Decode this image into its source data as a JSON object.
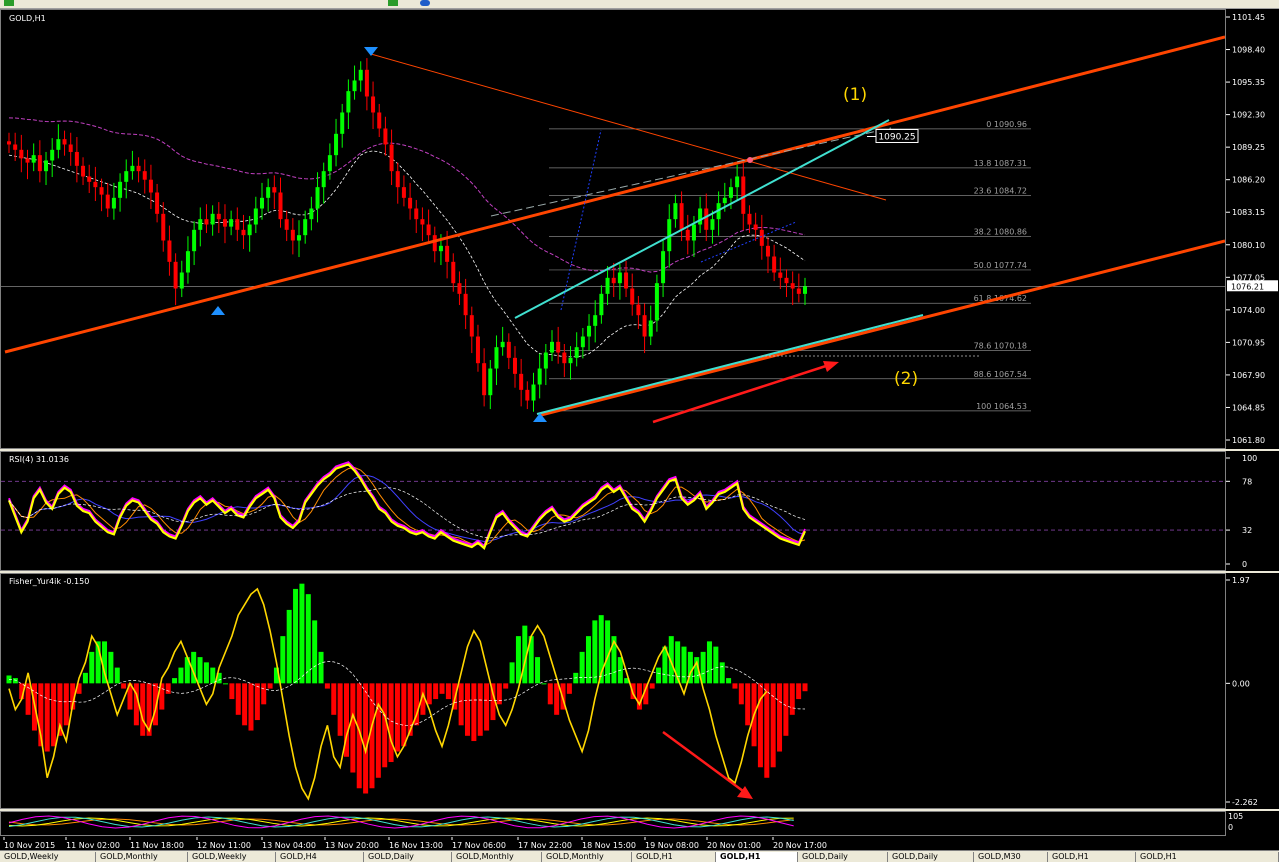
{
  "chart_data": [
    {
      "type": "line",
      "title": "GOLD,H1",
      "ylim": [
        1061.8,
        1101.45
      ],
      "yticks": [
        "1101.45",
        "1098.40",
        "1095.35",
        "1092.30",
        "1089.25",
        "1086.20",
        "1083.15",
        "1080.10",
        "1077.05",
        "1074.00",
        "1070.95",
        "1067.90",
        "1064.85",
        "1061.80"
      ],
      "current_price": "1076.21",
      "price_marker": "1090.25",
      "annotations": [
        "(1)",
        "(2)"
      ],
      "fib_levels": [
        {
          "label": "0 1090.96",
          "value": 1090.96
        },
        {
          "label": "13.8 1087.31",
          "value": 1087.31
        },
        {
          "label": "23.6 1084.72",
          "value": 1084.72
        },
        {
          "label": "38.2 1080.86",
          "value": 1080.86
        },
        {
          "label": "50.0 1077.74",
          "value": 1077.74
        },
        {
          "label": "61.8 1074.62",
          "value": 1074.62
        },
        {
          "label": "78.6 1070.18",
          "value": 1070.18
        },
        {
          "label": "88.6 1067.54",
          "value": 1067.54
        },
        {
          "label": "100 1064.53",
          "value": 1064.53
        }
      ],
      "close": [
        1089.5,
        1089.0,
        1088.2,
        1087.8,
        1088.5,
        1087.0,
        1088.0,
        1089.0,
        1090.0,
        1089.5,
        1088.8,
        1087.5,
        1086.5,
        1086.0,
        1085.5,
        1084.8,
        1083.5,
        1084.5,
        1086.0,
        1087.0,
        1087.5,
        1087.0,
        1086.2,
        1085.0,
        1083.0,
        1080.5,
        1078.5,
        1076.0,
        1077.5,
        1079.5,
        1081.5,
        1082.5,
        1082.0,
        1083.0,
        1082.5,
        1081.8,
        1082.5,
        1081.5,
        1081.0,
        1082.0,
        1083.5,
        1084.5,
        1085.5,
        1085.0,
        1082.5,
        1081.5,
        1080.5,
        1081.0,
        1082.5,
        1083.5,
        1085.5,
        1087.0,
        1088.5,
        1090.5,
        1092.5,
        1094.5,
        1095.5,
        1096.5,
        1094.0,
        1092.5,
        1091.0,
        1089.5,
        1087.0,
        1085.5,
        1084.5,
        1083.5,
        1082.5,
        1082.0,
        1081.0,
        1079.5,
        1080.0,
        1078.5,
        1076.5,
        1075.5,
        1073.5,
        1071.5,
        1069.0,
        1066.0,
        1068.5,
        1070.5,
        1071.0,
        1069.5,
        1068.0,
        1066.5,
        1065.5,
        1067.0,
        1068.5,
        1070.0,
        1071.0,
        1070.0,
        1069.0,
        1069.5,
        1070.5,
        1071.5,
        1072.5,
        1073.5,
        1075.5,
        1077.0,
        1076.5,
        1077.5,
        1076.0,
        1074.5,
        1073.5,
        1071.5,
        1073.0,
        1076.5,
        1079.5,
        1082.5,
        1084.0,
        1081.5,
        1080.5,
        1082.0,
        1083.5,
        1081.5,
        1082.5,
        1084.0,
        1084.5,
        1085.5,
        1086.5,
        1083.0,
        1082.0,
        1081.5,
        1080.0,
        1079.0,
        1077.5,
        1077.0,
        1076.5,
        1076.0,
        1075.5,
        1076.2
      ],
      "ma_fast": [
        1088.5,
        1088.4,
        1088.3,
        1088.2,
        1088.1,
        1088.0,
        1087.8,
        1087.6,
        1087.4,
        1087.2,
        1087.0,
        1086.8,
        1086.6,
        1086.4,
        1086.2,
        1086.0,
        1085.8,
        1085.6,
        1085.4,
        1085.3,
        1085.1,
        1084.9,
        1084.6,
        1084.3,
        1084.0,
        1083.6,
        1083.2,
        1082.8,
        1082.5,
        1082.3,
        1082.2,
        1082.1,
        1082.1,
        1082.2,
        1082.2,
        1082.2,
        1082.3,
        1082.3,
        1082.3,
        1082.4,
        1082.5,
        1082.8,
        1083.1,
        1083.3,
        1083.3,
        1083.2,
        1083.0,
        1082.9,
        1082.9,
        1083.1,
        1083.5,
        1084.0,
        1084.6,
        1085.3,
        1086.1,
        1087.0,
        1087.8,
        1088.5,
        1088.8,
        1088.9,
        1088.8,
        1088.6,
        1088.2,
        1087.7,
        1087.1,
        1086.5,
        1085.8,
        1085.2,
        1084.5,
        1083.8,
        1083.1,
        1082.4,
        1081.6,
        1080.8,
        1079.9,
        1078.9,
        1077.8,
        1076.6,
        1075.6,
        1074.7,
        1074.0,
        1073.2,
        1072.4,
        1071.6,
        1070.8,
        1070.3,
        1069.9,
        1069.8,
        1069.8,
        1069.7,
        1069.6,
        1069.6,
        1069.6,
        1069.7,
        1069.9,
        1070.3,
        1070.8,
        1071.4,
        1071.8,
        1072.2,
        1072.5,
        1072.6,
        1072.6,
        1072.5,
        1072.6,
        1073.0,
        1073.6,
        1074.4,
        1075.2,
        1075.7,
        1076.1,
        1076.6,
        1077.2,
        1077.6,
        1078.0,
        1078.6,
        1079.2,
        1079.9,
        1080.6,
        1080.9,
        1081.0,
        1081.0,
        1080.9,
        1080.7,
        1080.4,
        1080.1,
        1079.8,
        1079.4,
        1079.0,
        1078.6
      ]
    },
    {
      "type": "line",
      "title": "RSI(4) 31.0136",
      "ylim": [
        0,
        100
      ],
      "yticks": [
        "100",
        "78",
        "32",
        "0"
      ],
      "levels": [
        78,
        32
      ],
      "values": [
        60,
        45,
        30,
        40,
        62,
        70,
        58,
        52,
        66,
        72,
        68,
        55,
        50,
        48,
        40,
        35,
        30,
        28,
        44,
        55,
        60,
        58,
        50,
        42,
        38,
        30,
        26,
        24,
        36,
        50,
        58,
        62,
        56,
        60,
        54,
        48,
        52,
        46,
        44,
        54,
        62,
        66,
        70,
        62,
        44,
        38,
        34,
        40,
        58,
        66,
        74,
        80,
        84,
        90,
        92,
        94,
        88,
        80,
        70,
        62,
        52,
        48,
        40,
        36,
        34,
        30,
        28,
        30,
        26,
        24,
        30,
        26,
        22,
        20,
        18,
        16,
        20,
        15,
        30,
        44,
        48,
        40,
        34,
        28,
        26,
        34,
        42,
        48,
        52,
        44,
        40,
        42,
        48,
        54,
        58,
        62,
        70,
        74,
        68,
        72,
        62,
        52,
        48,
        40,
        50,
        62,
        70,
        78,
        80,
        62,
        56,
        60,
        66,
        52,
        58,
        66,
        68,
        72,
        76,
        52,
        44,
        40,
        36,
        32,
        28,
        24,
        22,
        20,
        18,
        31
      ]
    },
    {
      "type": "bar",
      "title": "Fisher_Yur4ik -0.150",
      "ylim": [
        -2.262,
        1.97
      ],
      "yticks": [
        "1.97",
        "0.00",
        "-2.262"
      ],
      "histogram": [
        0.15,
        0.1,
        -0.3,
        -0.6,
        -0.9,
        -1.2,
        -1.3,
        -1.2,
        -1.0,
        -0.8,
        -0.5,
        -0.2,
        0.2,
        0.6,
        0.8,
        0.8,
        0.6,
        0.3,
        -0.1,
        -0.5,
        -0.8,
        -1.0,
        -1.0,
        -0.8,
        -0.5,
        -0.2,
        0.1,
        0.3,
        0.5,
        0.6,
        0.5,
        0.4,
        0.3,
        0.2,
        0.0,
        -0.3,
        -0.6,
        -0.8,
        -0.9,
        -0.7,
        -0.4,
        -0.1,
        0.3,
        0.9,
        1.4,
        1.8,
        1.9,
        1.7,
        1.2,
        0.6,
        -0.1,
        -0.6,
        -1.0,
        -1.4,
        -1.7,
        -2.0,
        -2.1,
        -2.0,
        -1.8,
        -1.6,
        -1.5,
        -1.3,
        -1.2,
        -1.0,
        -0.8,
        -0.6,
        -0.4,
        -0.3,
        -0.2,
        -0.3,
        -0.5,
        -0.8,
        -1.0,
        -1.1,
        -1.0,
        -0.9,
        -0.7,
        -0.4,
        -0.1,
        0.4,
        0.9,
        1.1,
        0.9,
        0.5,
        0.0,
        -0.4,
        -0.6,
        -0.5,
        -0.2,
        0.2,
        0.6,
        0.9,
        1.2,
        1.3,
        1.2,
        0.9,
        0.5,
        0.1,
        -0.3,
        -0.5,
        -0.4,
        -0.1,
        0.3,
        0.7,
        0.9,
        0.8,
        0.7,
        0.6,
        0.5,
        0.6,
        0.8,
        0.7,
        0.4,
        0.1,
        -0.1,
        -0.4,
        -0.8,
        -1.2,
        -1.6,
        -1.8,
        -1.6,
        -1.3,
        -1.0,
        -0.6,
        -0.3,
        -0.15
      ],
      "signal": [
        -0.1,
        -0.5,
        -0.3,
        0.2,
        -0.4,
        -1.0,
        -1.8,
        -1.4,
        -0.8,
        -1.1,
        -0.4,
        0.1,
        0.4,
        0.9,
        0.7,
        0.2,
        -0.2,
        -0.6,
        -0.3,
        0.0,
        -0.2,
        -0.7,
        -0.9,
        -0.5,
        0.1,
        0.3,
        0.6,
        0.8,
        0.5,
        0.2,
        -0.1,
        -0.4,
        -0.2,
        0.3,
        0.6,
        0.9,
        1.3,
        1.5,
        1.7,
        1.8,
        1.5,
        1.0,
        0.4,
        -0.3,
        -1.0,
        -1.6,
        -2.0,
        -2.2,
        -1.8,
        -1.2,
        -0.8,
        -1.4,
        -1.6,
        -1.0,
        -0.6,
        -0.9,
        -1.3,
        -0.8,
        -0.4,
        -0.6,
        -1.1,
        -1.4,
        -1.2,
        -0.9,
        -0.6,
        -0.2,
        -0.5,
        -0.9,
        -1.2,
        -0.8,
        -0.3,
        0.2,
        0.7,
        1.0,
        0.8,
        0.3,
        -0.2,
        -0.6,
        -0.8,
        -0.5,
        -0.1,
        0.4,
        0.9,
        1.1,
        0.9,
        0.5,
        0.1,
        -0.3,
        -0.7,
        -1.0,
        -1.3,
        -0.9,
        -0.3,
        0.2,
        0.5,
        0.8,
        0.6,
        0.2,
        -0.2,
        -0.4,
        -0.1,
        0.2,
        0.5,
        0.7,
        0.4,
        0.1,
        -0.2,
        0.2,
        0.4,
        -0.1,
        -0.5,
        -1.0,
        -1.4,
        -1.8,
        -1.9,
        -1.5,
        -1.0,
        -0.6,
        -0.3,
        -0.15
      ]
    }
  ],
  "subwindow4": {
    "ticks": [
      "105",
      "0"
    ]
  },
  "time_axis": [
    "10 Nov 2015",
    "11 Nov 02:00",
    "11 Nov 18:00",
    "12 Nov 11:00",
    "13 Nov 04:00",
    "13 Nov 20:00",
    "16 Nov 13:00",
    "17 Nov 06:00",
    "17 Nov 22:00",
    "18 Nov 15:00",
    "19 Nov 08:00",
    "20 Nov 01:00",
    "20 Nov 17:00"
  ],
  "tabs": [
    "GOLD,Weekly",
    "GOLD,Monthly",
    "GOLD,Weekly",
    "GOLD,H4",
    "GOLD,Daily",
    "GOLD,Monthly",
    "GOLD,Monthly",
    "GOLD,H1",
    "GOLD,H1",
    "GOLD,Daily",
    "GOLD,Daily",
    "GOLD,M30",
    "GOLD,H1",
    "GOLD,H1"
  ],
  "active_tab_index": 8,
  "colors": {
    "bull": "#00ff00",
    "bear": "#ff0000",
    "trend": "#ff4500",
    "channel": "#40e0d0",
    "rsi": "#ffff00",
    "rsi_ma1": "#ff00ff",
    "rsi_ma2": "#4040ff",
    "signal": "#ffd700",
    "annotation": "#ffd700",
    "arrow": "#ff1a1a",
    "fib": "#808080",
    "ma_fast": "#ffffff",
    "ma_slow": "#c040c0"
  }
}
